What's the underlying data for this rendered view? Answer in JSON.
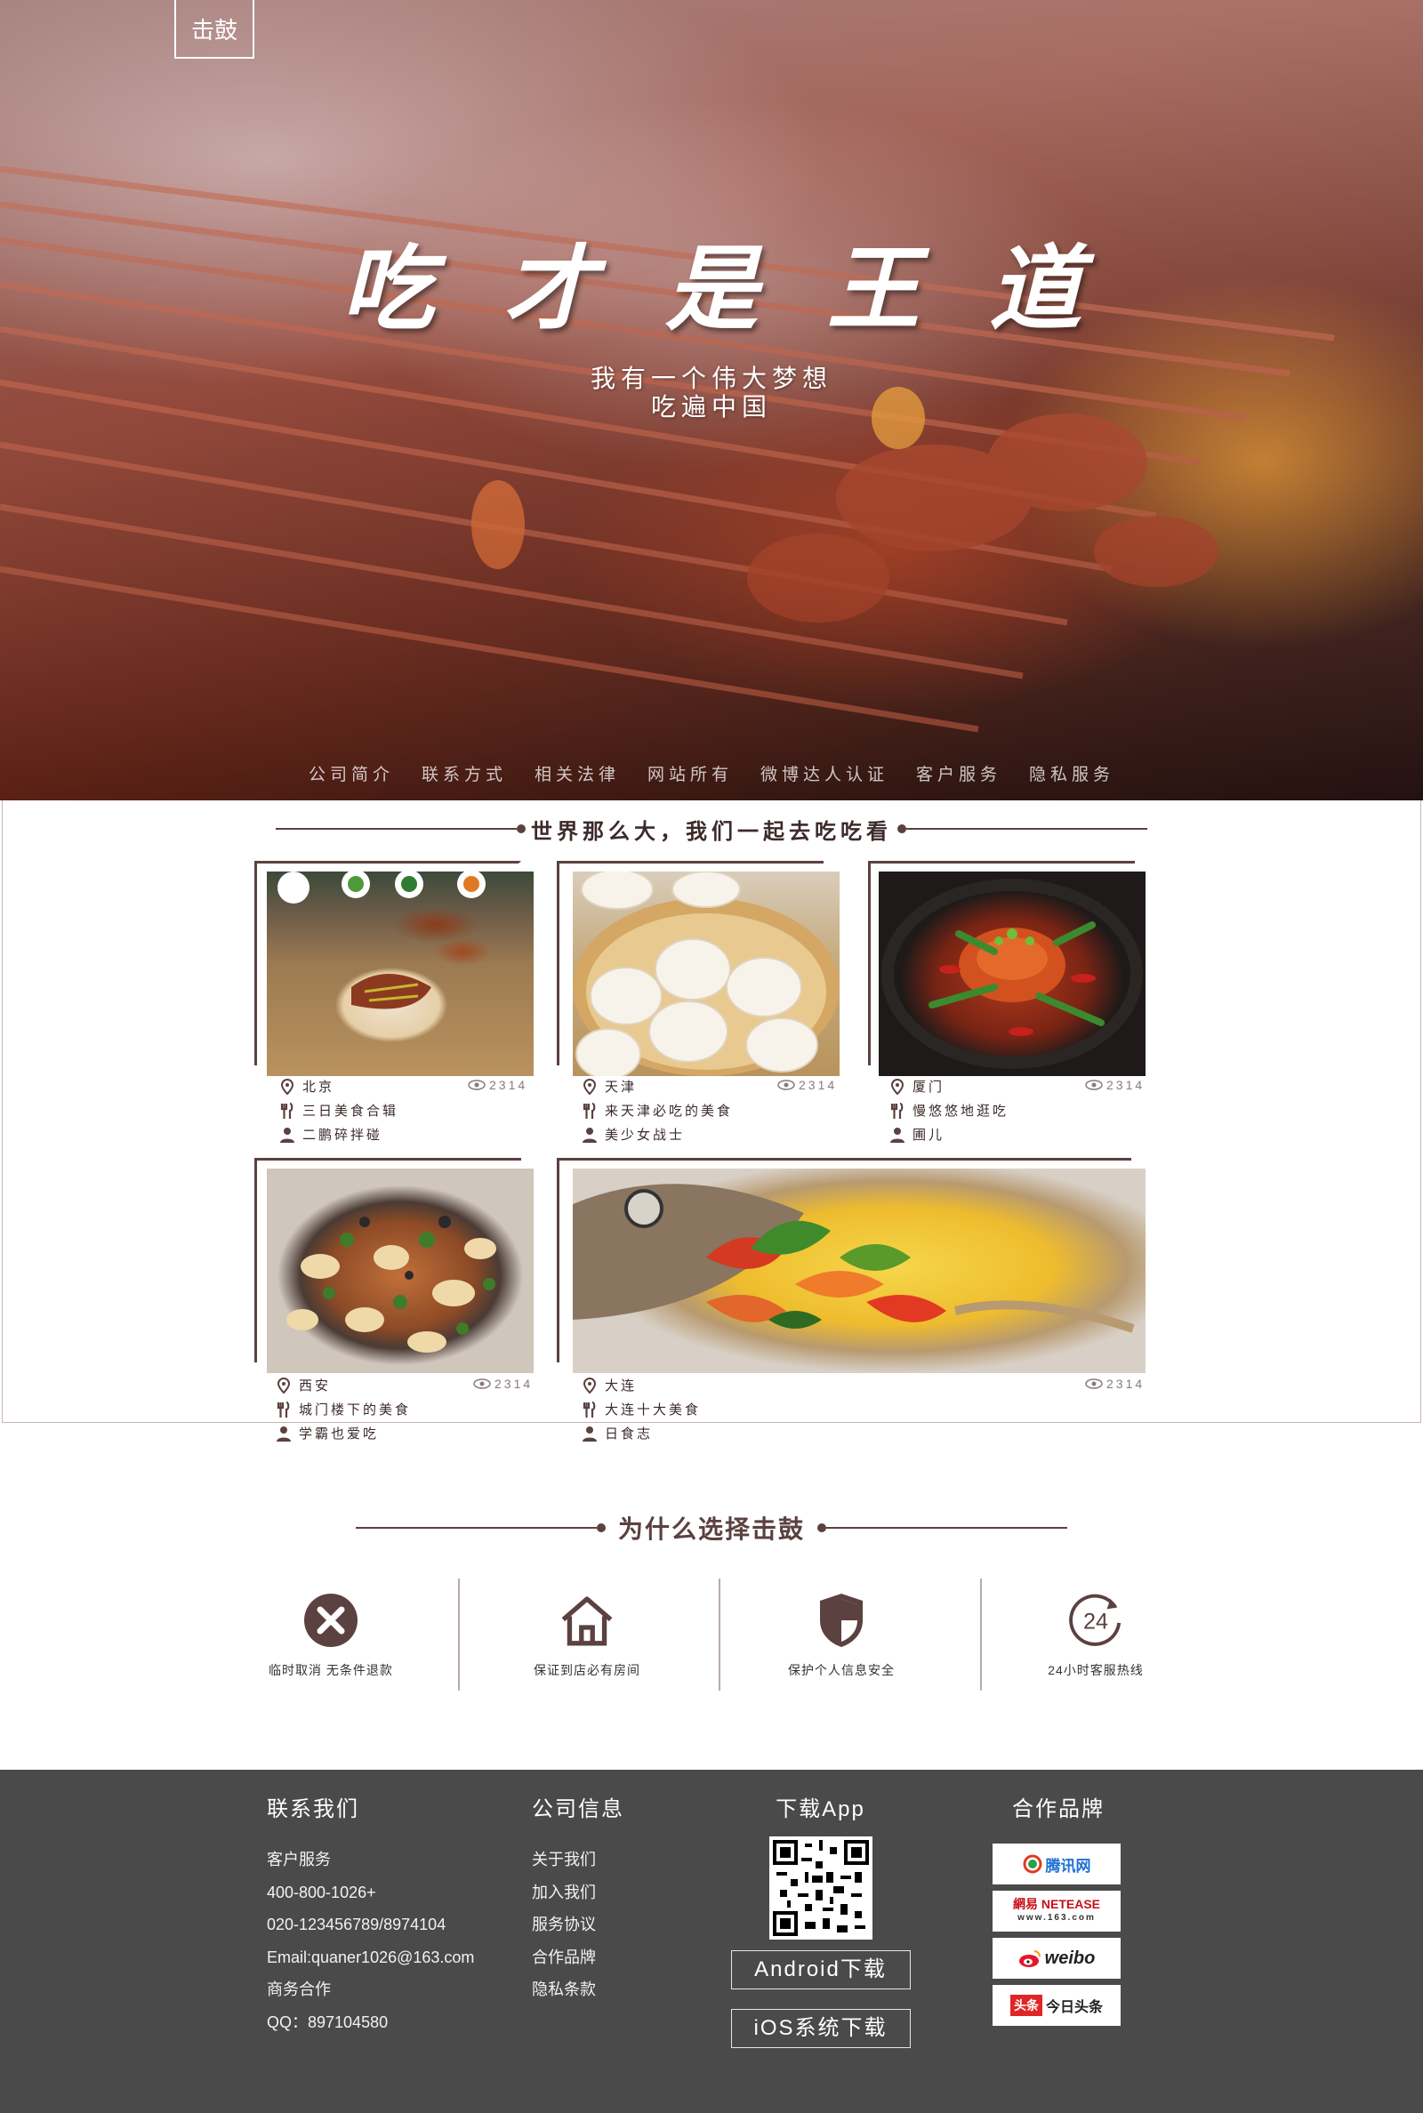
{
  "hero": {
    "logo_text": "击鼓",
    "title": "吃才是王道",
    "subtitle_line1": "我有一个伟大梦想",
    "subtitle_line2": "吃遍中国",
    "nav": [
      "公司简介",
      "联系方式",
      "相关法律",
      "网站所有",
      "微博达人认证",
      "客户服务",
      "隐私服务"
    ]
  },
  "food_section": {
    "title": "世界那么大，我们一起去吃吃看",
    "cards": [
      {
        "city": "北京",
        "views": "2314",
        "topic": "三日美食合辑",
        "author": "二鹏碎拌碰"
      },
      {
        "city": "天津",
        "views": "2314",
        "topic": "来天津必吃的美食",
        "author": "美少女战士"
      },
      {
        "city": "厦门",
        "views": "2314",
        "topic": "慢悠悠地逛吃",
        "author": "圃儿"
      },
      {
        "city": "西安",
        "views": "2314",
        "topic": "城门楼下的美食",
        "author": "学霸也爱吃"
      },
      {
        "city": "大连",
        "views": "2314",
        "topic": "大连十大美食",
        "author": "日食志"
      }
    ]
  },
  "why_section": {
    "title": "为什么选择击鼓",
    "features": [
      {
        "icon": "close-circle-icon",
        "label": "临时取消 无条件退款"
      },
      {
        "icon": "home-icon",
        "label": "保证到店必有房间"
      },
      {
        "icon": "shield-icon",
        "label": "保护个人信息安全"
      },
      {
        "icon": "24-hour-icon",
        "label": "24小时客服热线"
      }
    ]
  },
  "footer": {
    "contact": {
      "title": "联系我们",
      "lines": [
        "客户服务",
        "400-800-1026+",
        "020-123456789/8974104",
        "Email:quaner1026@163.com",
        "商务合作",
        "QQ：897104580"
      ]
    },
    "company": {
      "title": "公司信息",
      "links": [
        "关于我们",
        "加入我们",
        "服务协议",
        "合作品牌",
        "隐私条款"
      ]
    },
    "app": {
      "title": "下载App",
      "android": "Android下载",
      "ios": "iOS系统下载"
    },
    "brands": {
      "title": "合作品牌",
      "items": [
        "腾讯网 QQ.com",
        "網易 NETEASE www.163.com",
        "weibo",
        "头条 今日头条"
      ]
    }
  },
  "colors": {
    "accent": "#5b4140",
    "footer_bg": "#4a4a4a"
  }
}
